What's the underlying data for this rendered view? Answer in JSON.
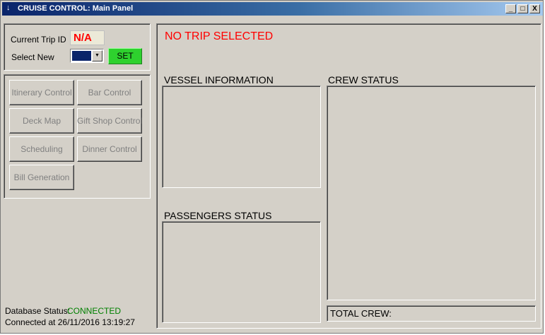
{
  "window": {
    "title": "CRUISE CONTROL: Main Panel",
    "minimize": "_",
    "maximize": "□",
    "close": "X"
  },
  "trip": {
    "current_trip_label": "Current Trip ID",
    "current_trip_value": "N/A",
    "select_new_label": "Select New",
    "select_value": "",
    "set_label": "SET"
  },
  "nav": {
    "buttons": [
      "Itinerary Control",
      "Bar Control",
      "Deck Map",
      "Gift Shop Control",
      "Scheduling",
      "Dinner Control",
      "Bill Generation"
    ]
  },
  "main": {
    "trip_status": "NO TRIP SELECTED",
    "vessel_info_label": "VESSEL INFORMATION",
    "crew_status_label": "CREW STATUS",
    "passengers_status_label": "PASSENGERS STATUS",
    "total_crew_label": "TOTAL CREW:"
  },
  "status": {
    "db_label": "Database Status:",
    "db_value": "CONNECTED",
    "connected_at": "Connected at 26/11/2016 13:19:27"
  },
  "colors": {
    "accent_red": "#ff0000",
    "connected_green": "#008000",
    "set_button_green": "#2ed12e",
    "title_bar": "#0a246a"
  }
}
